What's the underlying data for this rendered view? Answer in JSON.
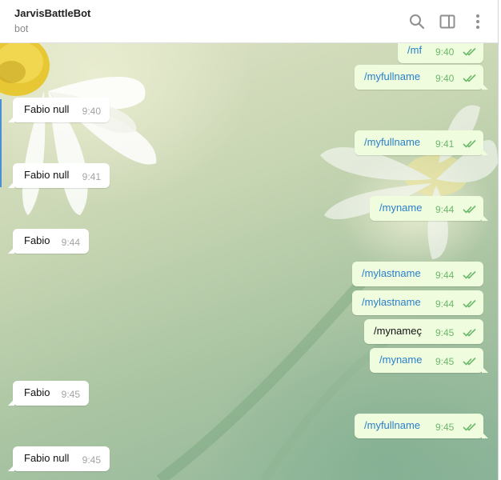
{
  "header": {
    "title": "JarvisBattleBot",
    "status": "bot",
    "icons": [
      "search-icon",
      "sidebar-toggle-icon",
      "more-vert-icon"
    ]
  },
  "colors": {
    "outgoing_bubble": "#effdde",
    "incoming_bubble": "#ffffff",
    "command_link": "#2a7fc9",
    "read_check": "#6cb86b"
  },
  "messages": [
    {
      "text": "/mf",
      "time": "9:40",
      "direction": "out",
      "command": true,
      "status": "read"
    },
    {
      "text": "/myfullname",
      "time": "9:40",
      "direction": "out",
      "command": true,
      "status": "read"
    },
    {
      "text": "Fabio null",
      "time": "9:40",
      "direction": "in"
    },
    {
      "text": "/myfullname",
      "time": "9:41",
      "direction": "out",
      "command": true,
      "status": "read"
    },
    {
      "text": "Fabio null",
      "time": "9:41",
      "direction": "in"
    },
    {
      "text": "/myname",
      "time": "9:44",
      "direction": "out",
      "command": true,
      "status": "read"
    },
    {
      "text": "Fabio",
      "time": "9:44",
      "direction": "in"
    },
    {
      "text": "/mylastname",
      "time": "9:44",
      "direction": "out",
      "command": true,
      "status": "read"
    },
    {
      "text": "/mylastname",
      "time": "9:44",
      "direction": "out",
      "command": true,
      "status": "read"
    },
    {
      "text": "/mynameç",
      "time": "9:45",
      "direction": "out",
      "command": false,
      "status": "read"
    },
    {
      "text": "/myname",
      "time": "9:45",
      "direction": "out",
      "command": true,
      "status": "read"
    },
    {
      "text": "Fabio",
      "time": "9:45",
      "direction": "in"
    },
    {
      "text": "/myfullname",
      "time": "9:45",
      "direction": "out",
      "command": true,
      "status": "read"
    },
    {
      "text": "Fabio null",
      "time": "9:45",
      "direction": "in"
    }
  ]
}
